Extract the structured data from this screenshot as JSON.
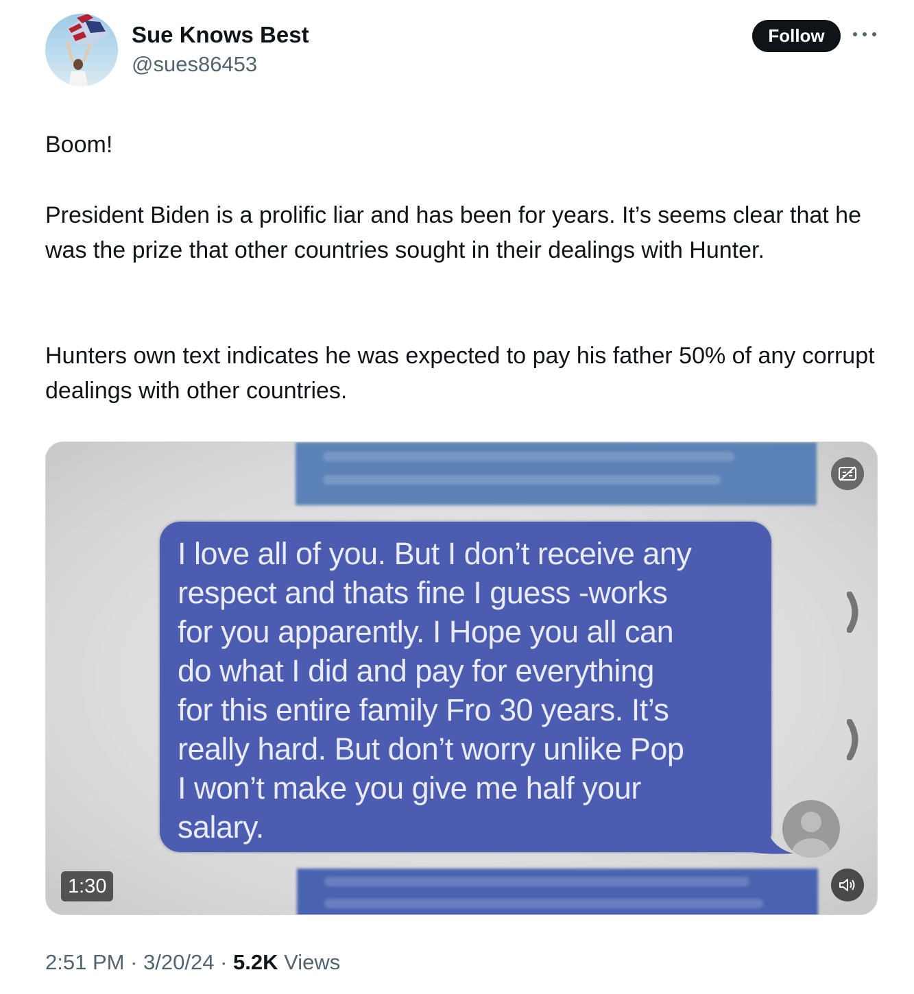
{
  "author": {
    "name": "Sue Knows Best",
    "handle": "@sues86453"
  },
  "follow_label": "Follow",
  "tweet": {
    "p1": "Boom!",
    "p2": "President Biden is a prolific liar and has been for years. It’s seems  clear that he was the prize that other countries sought in their dealings with Hunter.",
    "p3": "Hunters own text indicates he was expected to pay his father 50% of any corrupt dealings with other countries."
  },
  "video": {
    "duration": "1:30",
    "message_lines": [
      "I love all of you. But I don’t receive any",
      "respect and thats fine I guess -works",
      "for you apparently. I Hope you all can",
      "do what I did and pay for everything",
      "for this entire family Fro 30 years. It’s",
      "really hard. But don’t worry unlike Pop",
      "I won’t make you give me half your",
      "salary."
    ],
    "bubble_color": "#4c5cb1"
  },
  "meta": {
    "time": "2:51 PM",
    "date": "3/20/24",
    "views_count": "5.2K",
    "views_label": "Views"
  }
}
